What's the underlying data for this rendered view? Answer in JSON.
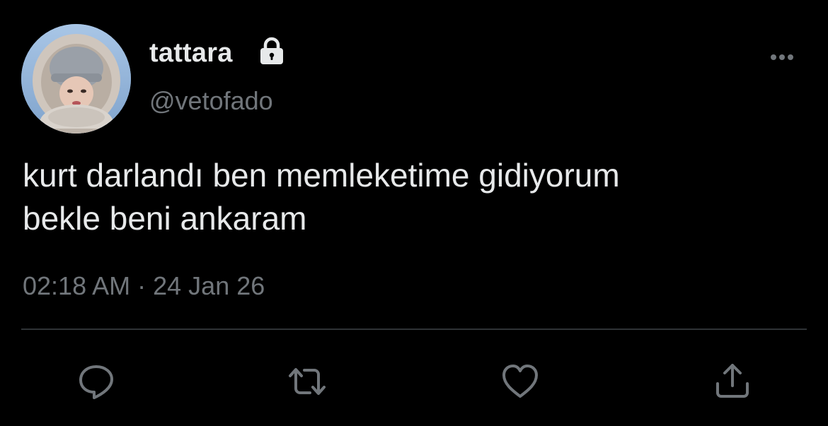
{
  "user": {
    "display_name": "tattara",
    "handle": "@vetofado",
    "protected_icon": "lock-icon",
    "avatar": "profile-photo"
  },
  "tweet": {
    "lines": [
      "kurt darlandı ben memleketime gidiyorum",
      "bekle beni ankaram"
    ],
    "time": "02:18 AM",
    "separator": "·",
    "date": "24 Jan 26"
  },
  "actions": [
    {
      "name": "reply",
      "icon": "reply-icon"
    },
    {
      "name": "retweet",
      "icon": "retweet-icon"
    },
    {
      "name": "like",
      "icon": "heart-icon"
    },
    {
      "name": "share",
      "icon": "share-icon"
    }
  ],
  "menu": {
    "icon": "more-icon"
  },
  "colors": {
    "background": "#000000",
    "text": "#e7e9ea",
    "secondary": "#71767b",
    "divider": "#2f3336"
  }
}
